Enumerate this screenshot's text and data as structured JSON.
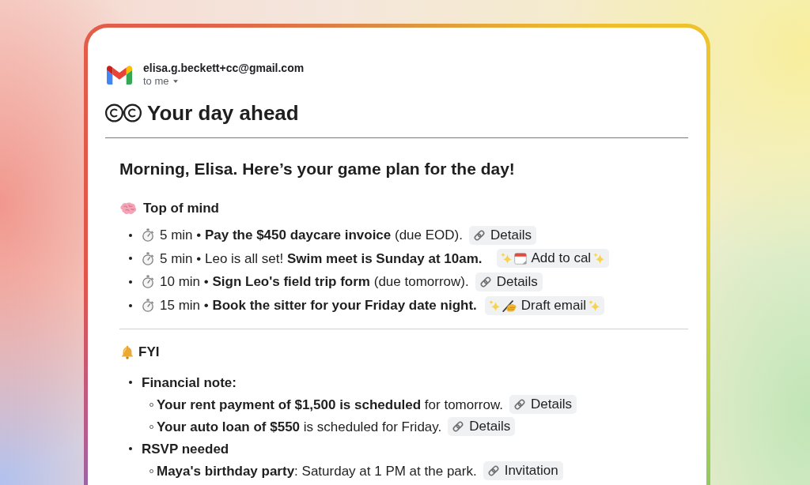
{
  "message": {
    "sender": "elisa.g.beckett+cc@gmail.com",
    "recipient": "to me",
    "subject": "Your day ahead",
    "greeting": "Morning, Elisa. Here’s your game plan for the day!",
    "sections": [
      {
        "kind": "tasks",
        "title": "Top of mind",
        "items": [
          {
            "text": "5 min • **Pay the $450 daycare invoice** (due EOD).",
            "action": {
              "kind": "link",
              "label": "Details"
            }
          },
          {
            "text": "5 min • Leo is all set! **Swim meet is Sunday at 10am.**",
            "action": {
              "kind": "calendar",
              "label": "Add to cal"
            }
          },
          {
            "text": "10 min • **Sign Leo's field trip form** (due tomorrow).",
            "action": {
              "kind": "link",
              "label": "Details"
            }
          },
          {
            "text": "15 min • **Book the sitter for your Friday date night.**",
            "action": {
              "kind": "draft",
              "label": "Draft email"
            }
          }
        ]
      },
      {
        "kind": "notes",
        "title": "FYI",
        "items": [
          {
            "text": "Financial note:",
            "children": [
              {
                "text": "**Your rent payment of $1,500 is scheduled** for tomorrow.",
                "action": {
                  "kind": "link",
                  "label": "Details"
                }
              },
              {
                "text": "**Your auto loan of $550** is scheduled for Friday.",
                "action": {
                  "kind": "link",
                  "label": "Details"
                }
              }
            ]
          },
          {
            "text": "RSVP needed",
            "children": [
              {
                "text": "**Maya's birthday party**: Saturday at 1 PM at the park.",
                "action": {
                  "kind": "link",
                  "label": "Invitation"
                }
              }
            ]
          }
        ]
      }
    ]
  }
}
